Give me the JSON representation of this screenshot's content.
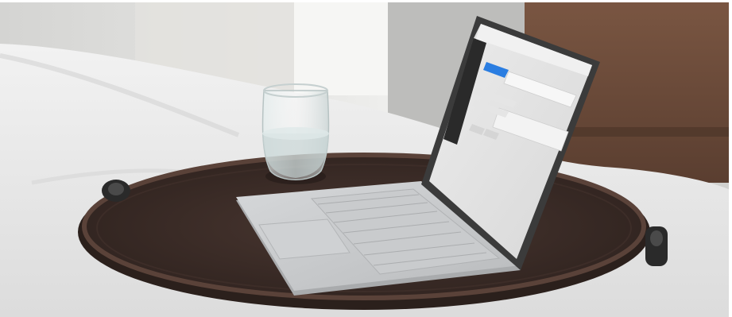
{
  "scene": {
    "subject": "laptop-on-wooden-tray",
    "colors": {
      "wall": "#d9d9d9",
      "curtain": "#e6e6e4",
      "bedding": "#eeeeee",
      "tray_wood": "#3b2c27",
      "tray_rim": "#4a3630",
      "headboard": "#6b4a38",
      "laptop_body": "#c3c5c7",
      "screen_bezel": "#3a3a3a",
      "screen_bg": "#e2e2e2",
      "screen_sidebar": "#2a2a2a",
      "accent_button": "#2a7de1",
      "glass_water": "#c9d6d6"
    }
  }
}
